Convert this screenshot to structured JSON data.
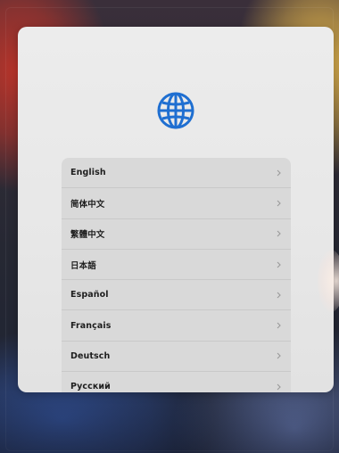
{
  "language_picker": {
    "items": [
      {
        "label": "English"
      },
      {
        "label": "简体中文"
      },
      {
        "label": "繁體中文"
      },
      {
        "label": "日本語"
      },
      {
        "label": "Español"
      },
      {
        "label": "Français"
      },
      {
        "label": "Deutsch"
      },
      {
        "label": "Русский"
      }
    ]
  },
  "colors": {
    "globe": "#1f6fd1",
    "chevron": "#9a9a9a",
    "sheet": "#e9e9e9",
    "list_background": "#d9d9d9",
    "text": "#1e1e1e"
  },
  "icons": {
    "header": "globe-icon",
    "row_accessory": "chevron-right-icon"
  }
}
